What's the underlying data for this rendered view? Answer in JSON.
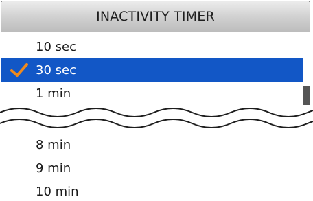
{
  "dialog": {
    "title": "INACTIVITY TIMER"
  },
  "options_top": [
    {
      "label": "10 sec",
      "selected": false
    },
    {
      "label": "30 sec",
      "selected": true
    },
    {
      "label": "1 min",
      "selected": false
    }
  ],
  "options_bottom": [
    {
      "label": "8 min",
      "selected": false
    },
    {
      "label": "9 min",
      "selected": false
    },
    {
      "label": "10 min",
      "selected": false
    }
  ],
  "icons": {
    "selected_marker": "checkmark-icon"
  },
  "colors": {
    "selection_bg": "#1257c6",
    "selection_text": "#ffffff",
    "checkmark": "#f08a1c",
    "title_bg": "#cfcfcf"
  }
}
